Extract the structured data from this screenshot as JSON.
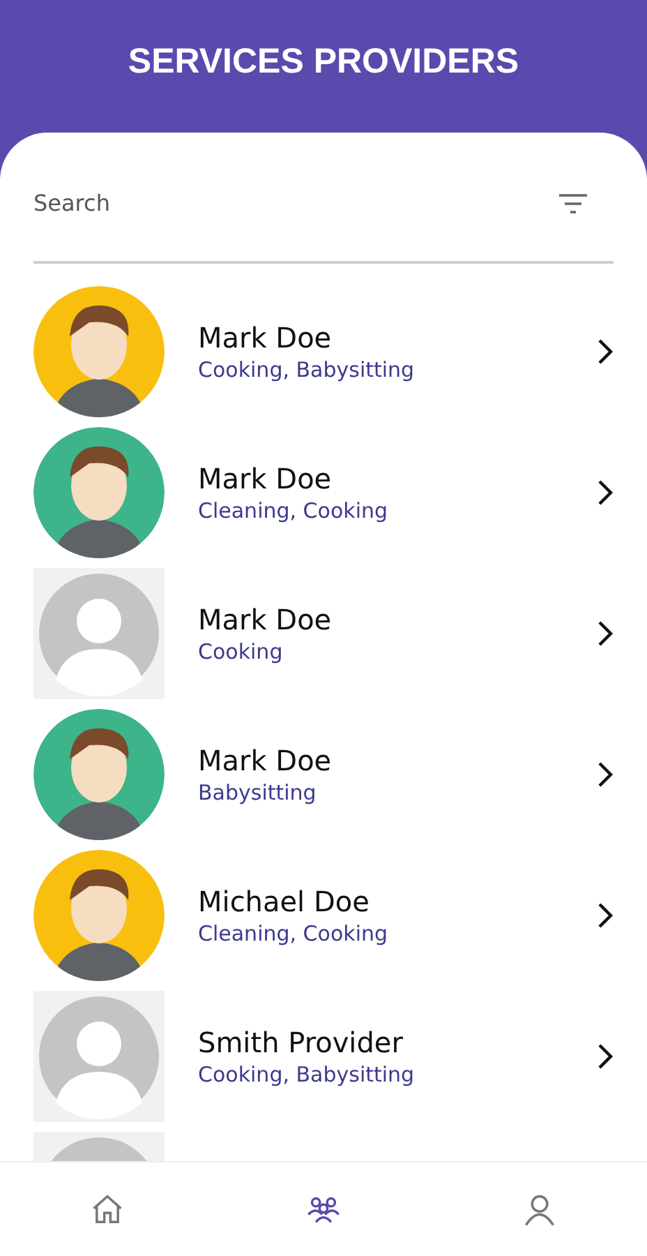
{
  "header": {
    "title": "SERVICES PROVIDERS"
  },
  "search": {
    "placeholder": "Search"
  },
  "providers": [
    {
      "name": "Mark Doe",
      "services": "Cooking, Babysitting",
      "kind": "illustrated",
      "color": "#f8bf0f"
    },
    {
      "name": "Mark Doe",
      "services": "Cleaning, Cooking",
      "kind": "illustrated",
      "color": "#3db489"
    },
    {
      "name": "Mark Doe",
      "services": "Cooking",
      "kind": "placeholder"
    },
    {
      "name": "Mark Doe",
      "services": "Babysitting",
      "kind": "illustrated",
      "color": "#3db489"
    },
    {
      "name": "Michael Doe",
      "services": "Cleaning, Cooking",
      "kind": "illustrated",
      "color": "#f8bf0f"
    },
    {
      "name": "Smith Provider",
      "services": "Cooking, Babysitting",
      "kind": "placeholder"
    },
    {
      "kind": "placeholder"
    }
  ],
  "nav": [
    {
      "kind": "home",
      "selected": false
    },
    {
      "kind": "providers",
      "selected": true
    },
    {
      "kind": "profile",
      "selected": false
    }
  ]
}
